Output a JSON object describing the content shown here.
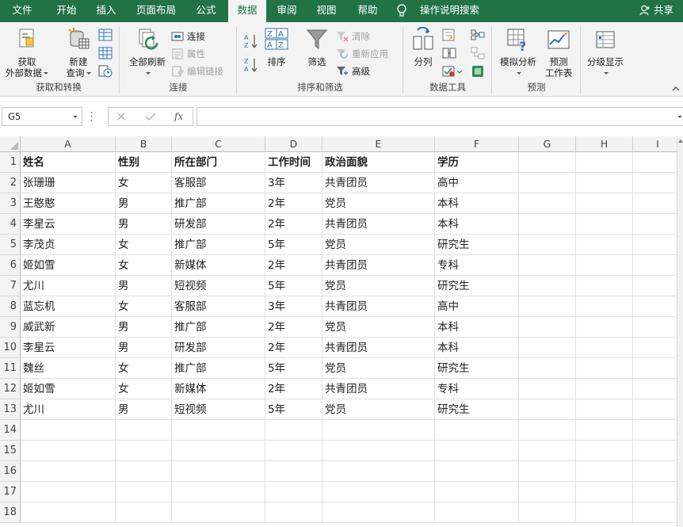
{
  "tabs": [
    {
      "label": "文件"
    },
    {
      "label": "开始"
    },
    {
      "label": "插入"
    },
    {
      "label": "页面布局"
    },
    {
      "label": "公式"
    },
    {
      "label": "数据"
    },
    {
      "label": "审阅"
    },
    {
      "label": "视图"
    },
    {
      "label": "帮助"
    }
  ],
  "tell_me": "操作说明搜索",
  "share": "共享",
  "ribbon": {
    "get_data": {
      "line1": "获取",
      "line2": "外部数据"
    },
    "new_query": {
      "line1": "新建",
      "line2": "查询"
    },
    "group_get_transform": "获取和转换",
    "refresh_all": "全部刷新",
    "connections": "连接",
    "properties": "属性",
    "edit_links": "编辑链接",
    "group_connections": "连接",
    "sort": "排序",
    "filter": "筛选",
    "clear": "清除",
    "reapply": "重新应用",
    "advanced": "高级",
    "group_sort_filter": "排序和筛选",
    "text_to_columns": "分列",
    "group_data_tools": "数据工具",
    "what_if": "模拟分析",
    "forecast_sheet": {
      "line1": "预测",
      "line2": "工作表"
    },
    "group_forecast": "预测",
    "outline": "分级显示"
  },
  "name_box": "G5",
  "formula_value": "",
  "columns": [
    "A",
    "B",
    "C",
    "D",
    "E",
    "F",
    "G",
    "H",
    "I"
  ],
  "row_numbers": [
    "1",
    "2",
    "3",
    "4",
    "5",
    "6",
    "7",
    "8",
    "9",
    "10",
    "11",
    "12",
    "13",
    "14",
    "15",
    "16",
    "17",
    "18"
  ],
  "header_row": [
    "姓名",
    "性别",
    "所在部门",
    "工作时间",
    "政治面貌",
    "学历"
  ],
  "rows": [
    [
      "张珊珊",
      "女",
      "客服部",
      "3年",
      "共青团员",
      "高中"
    ],
    [
      "王憨憨",
      "男",
      "推广部",
      "2年",
      "党员",
      "本科"
    ],
    [
      "李星云",
      "男",
      "研发部",
      "2年",
      "共青团员",
      "本科"
    ],
    [
      "李茂贞",
      "女",
      "推广部",
      "5年",
      "党员",
      "研究生"
    ],
    [
      "姬如雪",
      "女",
      "新媒体",
      "2年",
      "共青团员",
      "专科"
    ],
    [
      "尤川",
      "男",
      "短视频",
      "5年",
      "党员",
      "研究生"
    ],
    [
      "蓝忘机",
      "女",
      "客服部",
      "3年",
      "共青团员",
      "高中"
    ],
    [
      "威武新",
      "男",
      "推广部",
      "2年",
      "党员",
      "本科"
    ],
    [
      "李星云",
      "男",
      "研发部",
      "2年",
      "共青团员",
      "本科"
    ],
    [
      "魏丝",
      "女",
      "推广部",
      "5年",
      "党员",
      "研究生"
    ],
    [
      "姬如雪",
      "女",
      "新媒体",
      "2年",
      "共青团员",
      "专科"
    ],
    [
      "尤川",
      "男",
      "短视频",
      "5年",
      "党员",
      "研究生"
    ]
  ],
  "colors": {
    "ribbon_green": "#217346",
    "ribbon_bg": "#f3f3f3"
  }
}
